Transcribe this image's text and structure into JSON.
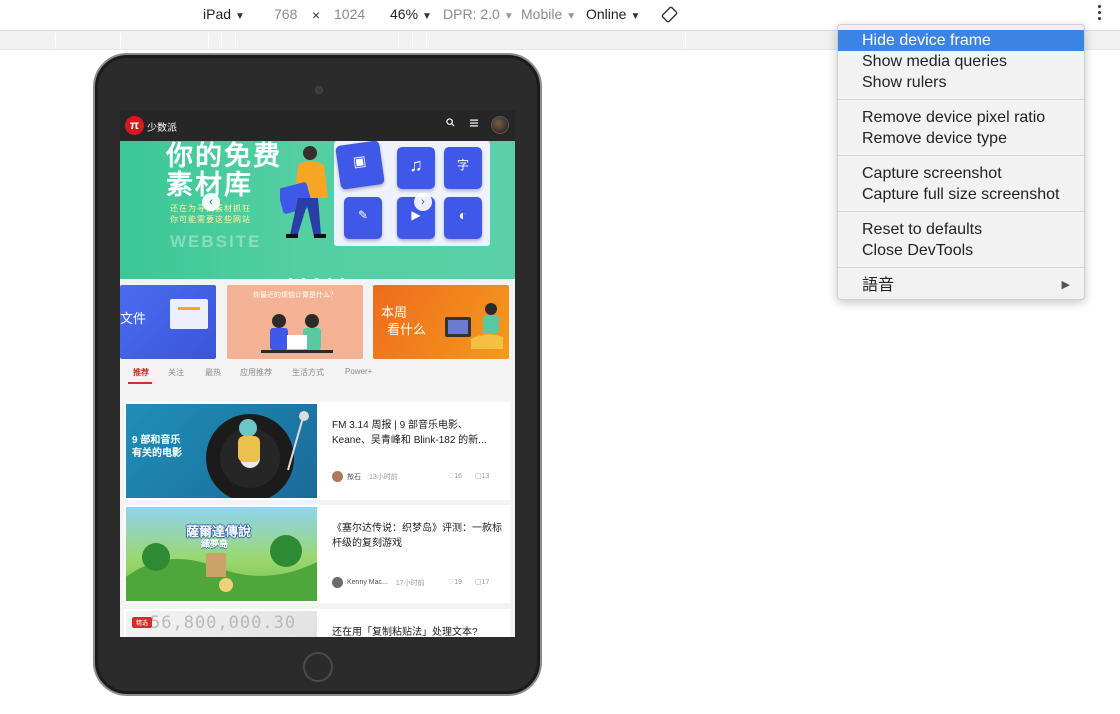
{
  "toolbar": {
    "device": "iPad",
    "width": "768",
    "times": "×",
    "height": "1024",
    "zoom": "46%",
    "dpr": "DPR: 2.0",
    "mode": "Mobile",
    "network": "Online"
  },
  "app": {
    "logo": "π",
    "brand": "少数派",
    "banner": {
      "headline_1": "你的免费",
      "headline_2": "素材库",
      "tagline_1": "还在为寻找素材抓狂",
      "tagline_2": "你可能需要这些网站",
      "ghost": "WEBSITE"
    },
    "promos": [
      {
        "text": "文件"
      },
      {
        "text": "你最近的烦恼计算是什么？"
      },
      {
        "text_1": "本周",
        "text_2": "看什么"
      }
    ],
    "tabs": [
      "推荐",
      "关注",
      "最热",
      "应用推荐",
      "生活方式",
      "Power+"
    ],
    "articles": [
      {
        "title": "FM 3.14 周报 | 9 部音乐电影、Keane、吴青峰和 Blink-182 的新...",
        "thumb_line_1": "9 部和音乐",
        "thumb_line_2": "有关的电影",
        "author": "揿石",
        "time": "13小时前",
        "likes": "16",
        "comments": "13"
      },
      {
        "title": "《塞尔达传说：织梦岛》评测：一款标杆级的复刻游戏",
        "thumb_line_1": "薩爾達傳說",
        "thumb_line_2": "織夢島",
        "author": "Kenny Mac...",
        "time": "17小时前",
        "likes": "19",
        "comments": "17"
      },
      {
        "title": "还在用「复制粘贴法」处理文本?",
        "badge": "精选"
      }
    ]
  },
  "menu": {
    "items": [
      [
        "Hide device frame",
        "Show media queries",
        "Show rulers"
      ],
      [
        "Remove device pixel ratio",
        "Remove device type"
      ],
      [
        "Capture screenshot",
        "Capture full size screenshot"
      ],
      [
        "Reset to defaults",
        "Close DevTools"
      ],
      [
        "語音"
      ]
    ],
    "highlighted": "Hide device frame",
    "submenu_arrow": "▶"
  },
  "colors": {
    "accent_red": "#d62b2b",
    "menu_highlight": "#3c84e4",
    "banner_green": "#3bc797"
  },
  "icons": [
    "chevron-down-icon",
    "rotate-icon",
    "more-vert-icon",
    "search-icon",
    "menu-icon",
    "chevron-left-icon",
    "chevron-right-icon",
    "like-icon",
    "comment-icon"
  ]
}
